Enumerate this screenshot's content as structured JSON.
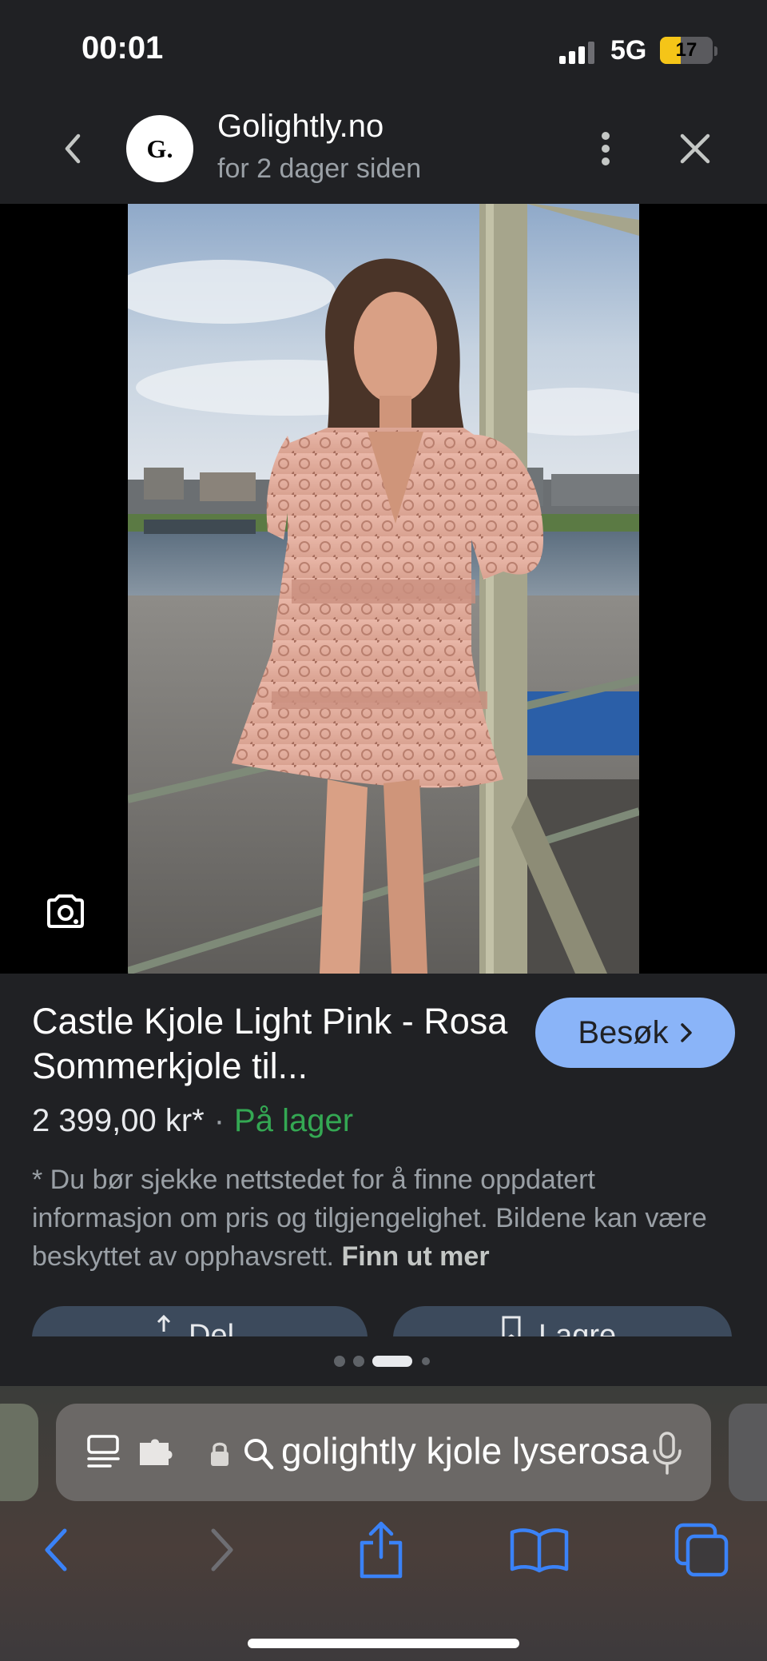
{
  "status_bar": {
    "time": "00:01",
    "network": "5G",
    "battery_level": "17"
  },
  "header": {
    "logo_text": "G.",
    "site_name": "Golightly.no",
    "posted": "for 2 dager siden",
    "icons": [
      "chevron-left-icon",
      "more-vertical-icon",
      "close-icon"
    ]
  },
  "image": {
    "alt": "Castle Kjole Light Pink",
    "lens_icon": "google-lens-icon"
  },
  "product": {
    "title": "Castle Kjole Light Pink - Rosa Sommerkjole til...",
    "visit_label": "Besøk",
    "price": "2 399,00 kr*",
    "separator": "·",
    "availability": "På lager",
    "disclaimer": "* Du bør sjekke nettstedet for å finne oppdatert informasjon om pris og tilgjengelighet. Bildene kan være beskyttet av opphavsrett.",
    "learn_more": "Finn ut mer",
    "share_label": "Del",
    "save_label": "Lagre"
  },
  "pager": {
    "count": 4,
    "active_index": 2
  },
  "safari": {
    "url_text": "golightly kjole lyserosa",
    "colors": {
      "accent": "#3a82f7",
      "disabled": "#6e6e73"
    }
  }
}
